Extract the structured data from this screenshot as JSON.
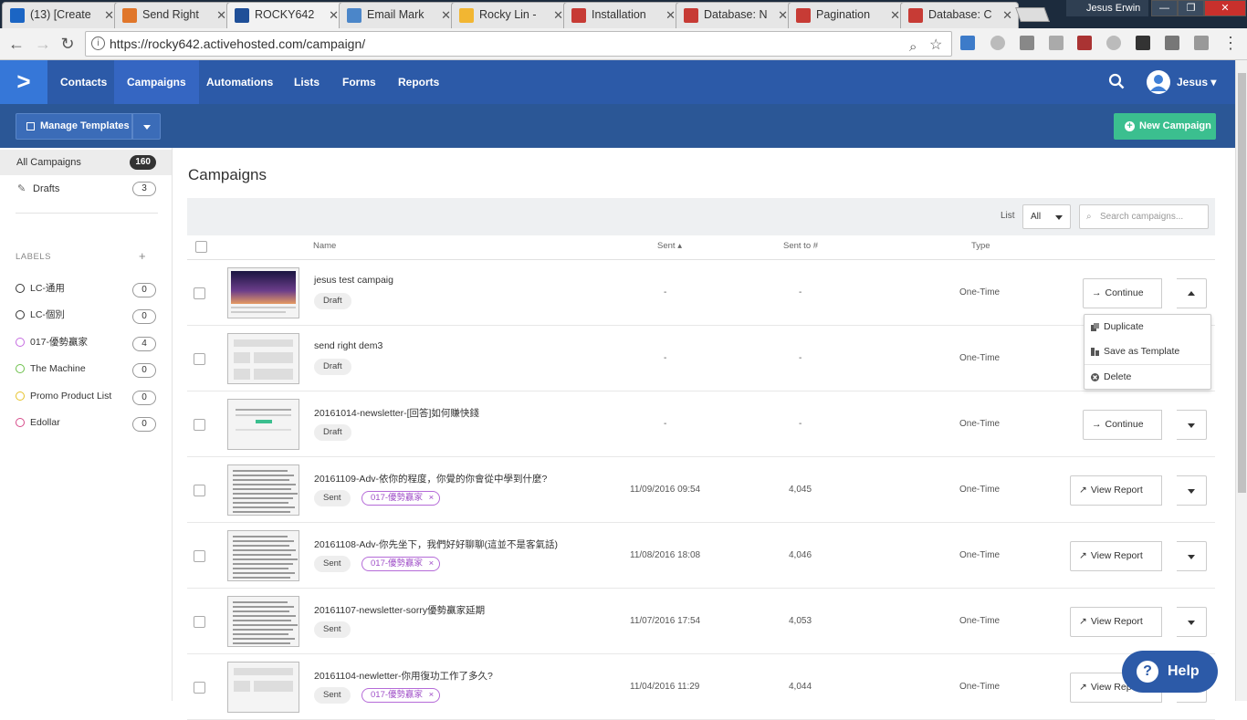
{
  "browser": {
    "tabs": [
      {
        "title": "(13) [Create",
        "color": "#1b65c4"
      },
      {
        "title": "Send Right",
        "color": "#e0762a"
      },
      {
        "title": "ROCKY642",
        "color": "#1f4f98"
      },
      {
        "title": "Email Mark",
        "color": "#4b86c9"
      },
      {
        "title": "Rocky Lin -",
        "color": "#f2b632"
      },
      {
        "title": "Installation",
        "color": "#c73b35"
      },
      {
        "title": "Database: N",
        "color": "#c73b35"
      },
      {
        "title": "Pagination",
        "color": "#c73b35"
      },
      {
        "title": "Database: C",
        "color": "#c73b35"
      }
    ],
    "tab_close": "✕",
    "user": "Jesus Erwin",
    "url": "https://rocky642.activehosted.com/campaign/",
    "win_min": "—",
    "win_max": "❐",
    "win_close": "✕"
  },
  "nav": {
    "logo": ">",
    "items": [
      "Contacts",
      "Campaigns",
      "Automations",
      "Lists",
      "Forms",
      "Reports"
    ],
    "user_name": "Jesus"
  },
  "subbar": {
    "manage_templates": "Manage Templates",
    "new_campaign": "New Campaign"
  },
  "sidebar": {
    "all_campaigns": "All Campaigns",
    "all_count": "160",
    "drafts": "Drafts",
    "drafts_count": "3",
    "labels_title": "LABELS",
    "add": "+",
    "labels": [
      {
        "name": "LC-通用",
        "count": "0",
        "color": "#333333"
      },
      {
        "name": "LC-個別",
        "count": "0",
        "color": "#333333"
      },
      {
        "name": "017-優勢贏家",
        "count": "4",
        "color": "#c56be0"
      },
      {
        "name": "The Machine",
        "count": "0",
        "color": "#6cc04a"
      },
      {
        "name": "Promo Product List",
        "count": "0",
        "color": "#e6c229"
      },
      {
        "name": "Edollar",
        "count": "0",
        "color": "#d64b8a"
      }
    ]
  },
  "main": {
    "title": "Campaigns",
    "list_label": "List",
    "list_value": "All",
    "search_placeholder": "Search campaigns...",
    "columns": {
      "name": "Name",
      "sent": "Sent",
      "sent_to": "Sent to #",
      "type": "Type"
    },
    "rows": [
      {
        "name": "jesus test campaig",
        "status": "Draft",
        "tag": "",
        "sent": "-",
        "sent_to": "-",
        "type": "One-Time",
        "action": "Continue"
      },
      {
        "name": "send right dem3",
        "status": "Draft",
        "tag": "",
        "sent": "-",
        "sent_to": "-",
        "type": "One-Time",
        "action": ""
      },
      {
        "name": "20161014-newsletter-[回答]如何賺快錢",
        "status": "Draft",
        "tag": "",
        "sent": "-",
        "sent_to": "-",
        "type": "One-Time",
        "action": "Continue"
      },
      {
        "name": "20161109-Adv-依你的程度，你覺的你會從中學到什麼?",
        "status": "Sent",
        "tag": "017-優勢贏家",
        "sent": "11/09/2016 09:54",
        "sent_to": "4,045",
        "type": "One-Time",
        "action": "View Report"
      },
      {
        "name": "20161108-Adv-你先坐下，我們好好聊聊(這並不是客氣話)",
        "status": "Sent",
        "tag": "017-優勢贏家",
        "sent": "11/08/2016 18:08",
        "sent_to": "4,046",
        "type": "One-Time",
        "action": "View Report"
      },
      {
        "name": "20161107-newsletter-sorry優勢贏家延期",
        "status": "Sent",
        "tag": "",
        "sent": "11/07/2016 17:54",
        "sent_to": "4,053",
        "type": "One-Time",
        "action": "View Report"
      },
      {
        "name": "20161104-newletter-你用復功工作了多久?",
        "status": "Sent",
        "tag": "017-優勢贏家",
        "sent": "11/04/2016 11:29",
        "sent_to": "4,044",
        "type": "One-Time",
        "action": "View Report"
      }
    ],
    "menu": [
      "Duplicate",
      "Save as Template",
      "Delete"
    ]
  },
  "help": "Help"
}
